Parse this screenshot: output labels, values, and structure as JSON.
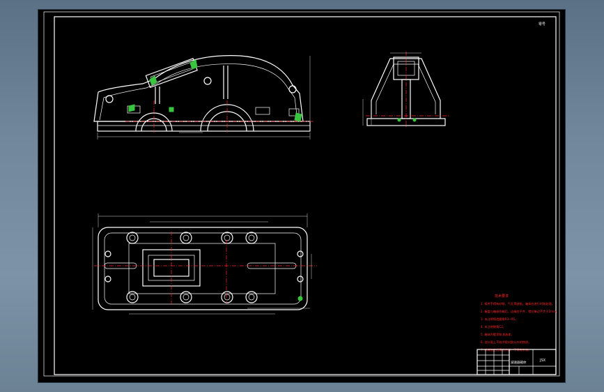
{
  "drawing": {
    "title": "Gearbox housing – assembly drawing (3 views)",
    "sheet_tag": "零号",
    "notes": {
      "heading": "技术要求",
      "items": [
        "1. 铸件不得有砂眼、气孔等缺陷，箱体应进行时效处理。",
        "2. 箱盖与箱座合箱后，边缘应平齐，错位每边不大于2mm。",
        "3. 未注明铸造圆角R3~R5。",
        "4. 未注明倒角C2。",
        "5. 箱体内壁涂耐油油漆。",
        "6. 剖分面上不准涂密封胶以外的物质。",
        "7. 机械加工后清洗内部，不得有杂物。"
      ]
    },
    "title_block": {
      "name": "减速器箱体",
      "code": "JSX"
    },
    "colors": {
      "outline": "#ffffff",
      "centerline": "#ff2a2a",
      "highlight": "#39c53f",
      "background": "#000000"
    }
  }
}
